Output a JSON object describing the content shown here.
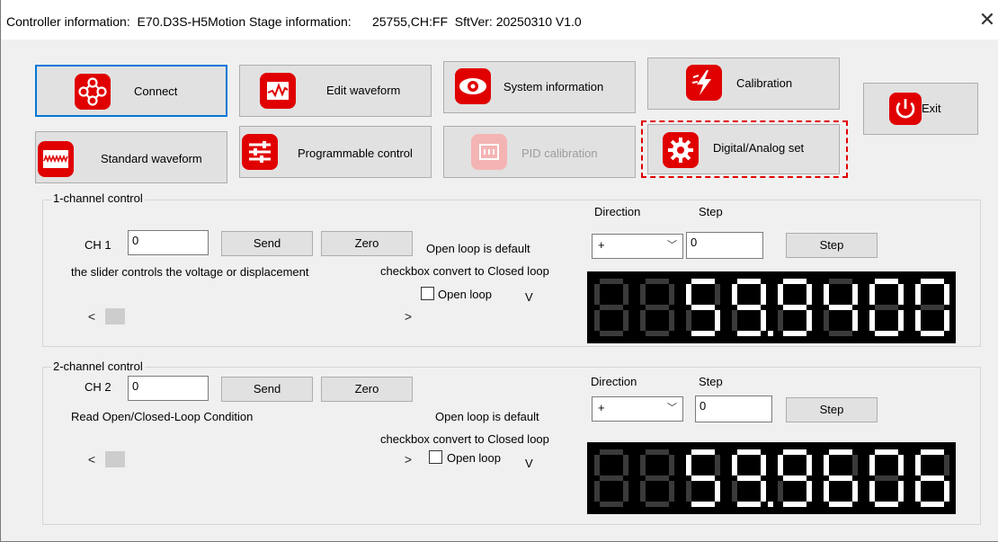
{
  "window": {
    "title": "Controller information:  E70.D3S-H5Motion Stage information:      25755,CH:FF  SftVer: 20250310 V1.0",
    "close_glyph": "✕"
  },
  "toolbar": {
    "connect": {
      "label": "Connect",
      "icon": "nodes-icon"
    },
    "edit_waveform": {
      "label": "Edit waveform",
      "icon": "waveform-edit-icon"
    },
    "system_information": {
      "label": "System information",
      "icon": "eye-icon"
    },
    "calibration": {
      "label": "Calibration",
      "icon": "lightning-icon"
    },
    "exit": {
      "label": "Exit",
      "icon": "power-icon"
    },
    "standard_waveform": {
      "label": "Standard waveform",
      "icon": "waveform-icon"
    },
    "programmable_control": {
      "label": "Programmable control",
      "icon": "sliders-icon"
    },
    "pid_calibration": {
      "label": "PID calibration",
      "icon": "chip-icon",
      "disabled": true
    },
    "digital_analog_set": {
      "label": "Digital/Analog set",
      "icon": "gear-icon"
    }
  },
  "ch1": {
    "group_title": "1-channel control",
    "ch_label": "CH 1",
    "value": "0",
    "send": "Send",
    "zero": "Zero",
    "slider_hint": "the slider controls the voltage or displacement",
    "open_loop_note": "Open loop is default",
    "checkbox_note": "checkbox convert to Closed loop",
    "open_loop_label": "Open loop",
    "unit": "V",
    "direction_label": "Direction",
    "step_label": "Step",
    "direction_value": "+",
    "step_value": "0",
    "step_button": "Step",
    "display_value": "59.9400",
    "scroll_left": "<",
    "scroll_right": ">"
  },
  "ch2": {
    "group_title": "2-channel control",
    "ch_label": "CH 2",
    "value": "0",
    "send": "Send",
    "zero": "Zero",
    "status_label": "Read Open/Closed-Loop Condition",
    "open_loop_note": "Open loop is default",
    "checkbox_note": "checkbox convert to Closed loop",
    "open_loop_label": "Open loop",
    "unit": "V",
    "direction_label": "Direction",
    "step_label": "Step",
    "direction_value": "+",
    "step_value": "0",
    "step_button": "Step",
    "display_value": "59.9606",
    "scroll_left": "<",
    "scroll_right": ">"
  },
  "colors": {
    "icon_red": "#e00000",
    "focus_blue": "#0078d7",
    "display_bg": "#000000",
    "segment_on": "#ffffff",
    "segment_off": "#3a3a3a"
  }
}
